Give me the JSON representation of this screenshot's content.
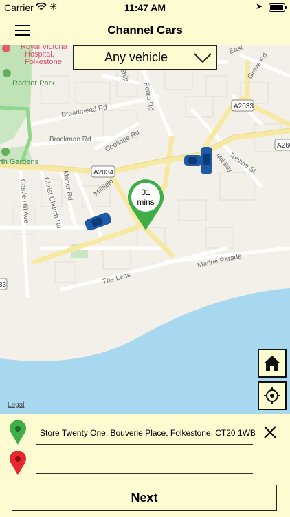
{
  "status_bar": {
    "carrier": "Carrier",
    "time": "11:47 AM"
  },
  "header": {
    "title": "Channel Cars",
    "menu_icon": "hamburger-icon"
  },
  "vehicle_select": {
    "selected": "Any vehicle"
  },
  "map": {
    "eta_value": "01",
    "eta_unit": "mins",
    "legal": "Legal",
    "labels": {
      "hospital_1": "Royal Victoria",
      "hospital_2": "Hospital,",
      "hospital_3": "Folkestone",
      "radnor_park": "Radnor Park",
      "gardens": "rth Gardens",
      "broadmead": "Broadmead Rd",
      "brockman": "Brockman Rd",
      "coolinge": "Coolinge Rd",
      "foord": "Foord Rd",
      "grove": "Grove Rd",
      "ship": "Ship",
      "a2033": "A2033",
      "a2034": "A2034",
      "a260": "A260",
      "a2034_left": "33",
      "tontine": "Tontine St",
      "mill_bay": "Mill Bay",
      "millfield": "Millfield",
      "manor": "Manor Rd",
      "christ_church": "Christ Church Rd",
      "castle_hill": "Castle Hill Ave",
      "the_leas": "The Leas",
      "marine_parade": "Marine Parade",
      "east": "East"
    },
    "controls": {
      "home_icon": "home-icon",
      "locate_icon": "crosshair-icon"
    }
  },
  "booking": {
    "pickup": "Store Twenty One, Bouverie Place, Folkestone, CT20 1WB",
    "dropoff": "",
    "next_label": "Next"
  },
  "colors": {
    "background": "#fdfbd0",
    "pickup_pin": "#3fae49",
    "dropoff_pin": "#e8262b",
    "sea": "#a7d8f0"
  }
}
